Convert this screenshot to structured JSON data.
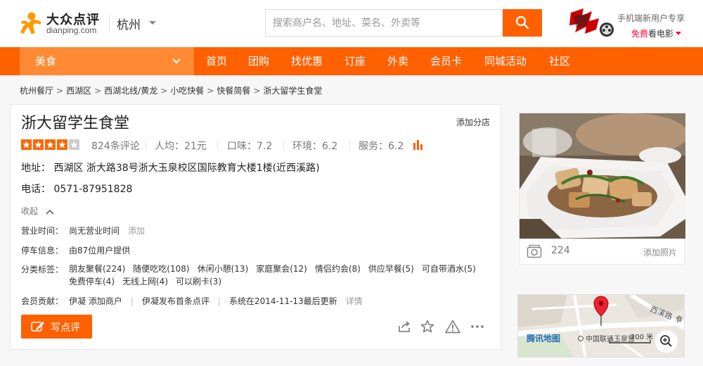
{
  "header": {
    "logo_cn": "大众点评",
    "logo_en": "dianping.com",
    "city": "杭州",
    "search_placeholder": "搜索商户名、地址、菜名、外卖等",
    "promo_line1": "手机端新用户专享",
    "promo_free": "免费",
    "promo_movie": "看电影"
  },
  "nav": {
    "category": "美食",
    "items": [
      "首页",
      "团购",
      "找优惠",
      "订座",
      "外卖",
      "会员卡",
      "同城活动",
      "社区"
    ]
  },
  "breadcrumb": [
    "杭州餐厅",
    "西湖区",
    "西湖北线/黄龙",
    "小吃快餐",
    "快餐简餐",
    "浙大留学生食堂"
  ],
  "shop": {
    "name": "浙大留学生食堂",
    "add_branch": "添加分店",
    "rating_stars": 4,
    "rating_max": 5,
    "reviews": "824条评论",
    "avg_price": "人均：21元",
    "taste": "口味：7.2",
    "environment": "环境：6.2",
    "service": "服务：6.2",
    "address": "地址： 西湖区 浙大路38号浙大玉泉校区国际教育大楼1楼(近西溪路)",
    "phone": "电话： 0571-87951828",
    "collapse_label": "收起",
    "hours_label": "营业时间：",
    "hours_value": "尚无营业时间",
    "hours_add": "添加",
    "parking_label": "停车信息：",
    "parking_value": "由87位用户提供",
    "tags_label": "分类标签：",
    "tags": [
      "朋友聚餐(224)",
      "随便吃吃(108)",
      "休闲小憩(13)",
      "家庭聚会(12)",
      "情侣约会(8)",
      "供应早餐(5)",
      "可自带酒水(5)",
      "免费停车(4)",
      "无线上网(4)",
      "可以刷卡(3)"
    ],
    "contrib_label": "会员贡献：",
    "contrib_1": "伊凝 添加商户",
    "contrib_2": "伊凝发布首条点评",
    "contrib_3": "系统在2014-11-13最后更新",
    "contrib_detail": "详情",
    "write_review": "写点评"
  },
  "photos": {
    "count": "224",
    "add_label": "添加照片"
  },
  "map": {
    "brand": "腾讯地图",
    "road": "西溪路",
    "poi": "中国联通玉泉营",
    "scale": "200 米",
    "edge_label": "食"
  },
  "colors": {
    "brand_orange": "#ff6000",
    "nav_active": "#ff8a33",
    "star": "#ff6600"
  }
}
